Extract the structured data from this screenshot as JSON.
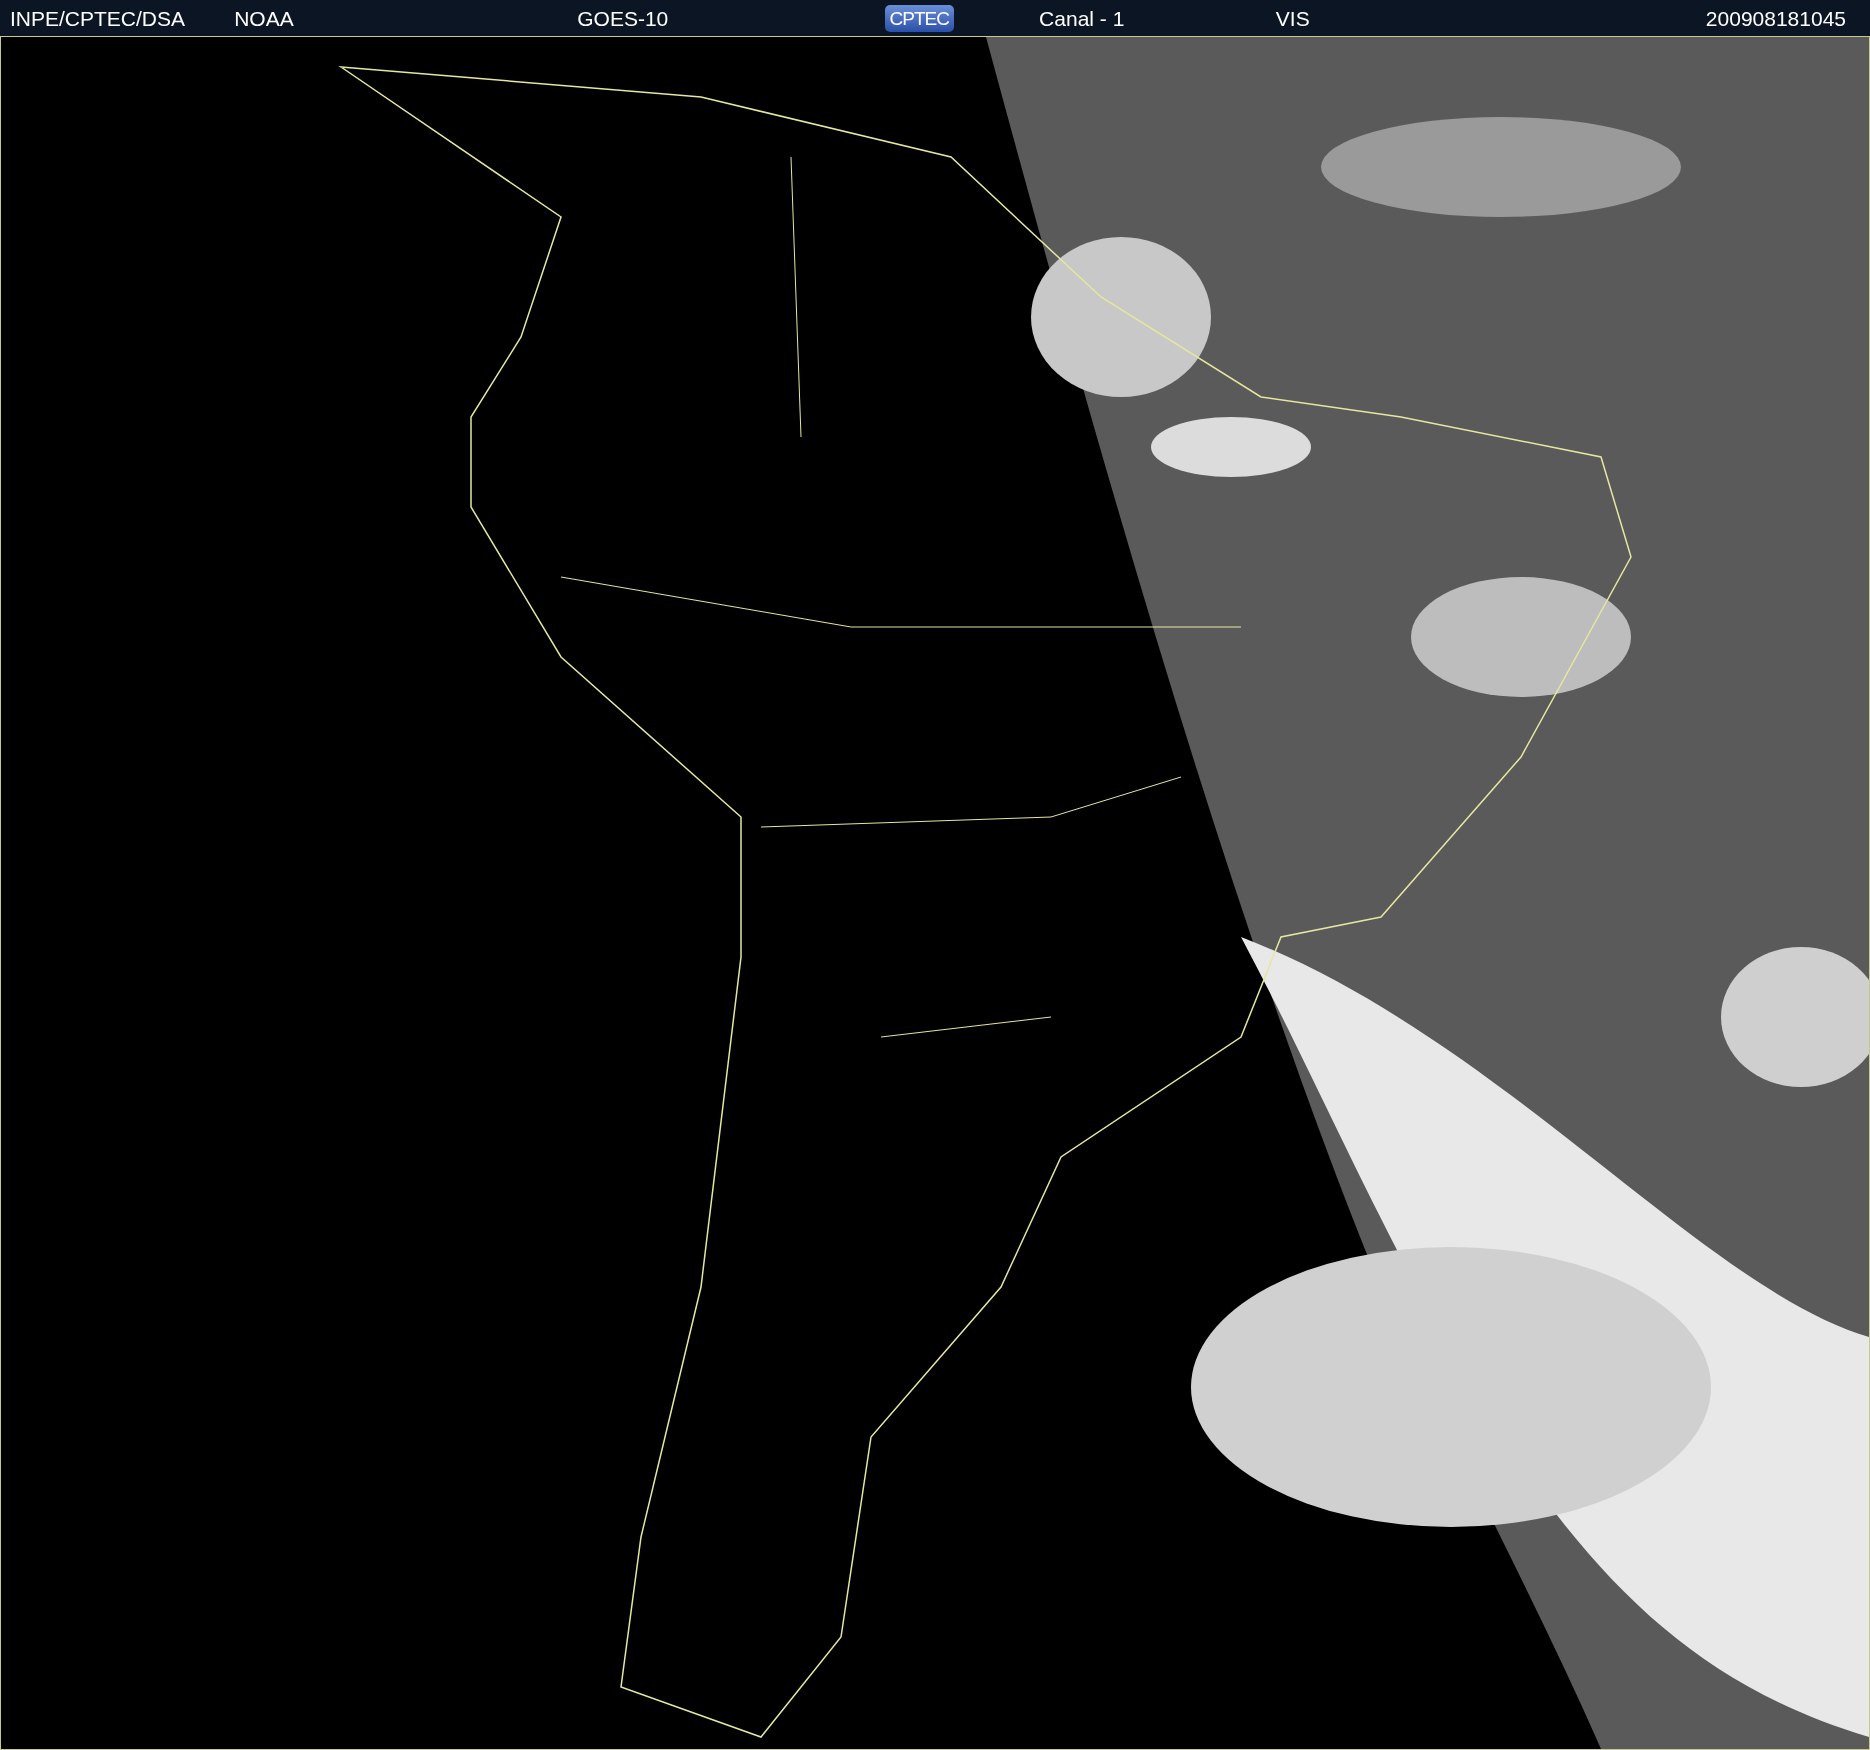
{
  "header": {
    "items": [
      {
        "kind": "text",
        "text": "INPE/CPTEC/DSA"
      },
      {
        "kind": "text",
        "text": "NOAA"
      },
      {
        "kind": "text",
        "text": "GOES-10"
      },
      {
        "kind": "logo",
        "text": "CPTEC"
      },
      {
        "kind": "text",
        "text": "Canal - 1"
      },
      {
        "kind": "text",
        "text": "VIS"
      },
      {
        "kind": "text",
        "text": "200908181045"
      }
    ]
  }
}
